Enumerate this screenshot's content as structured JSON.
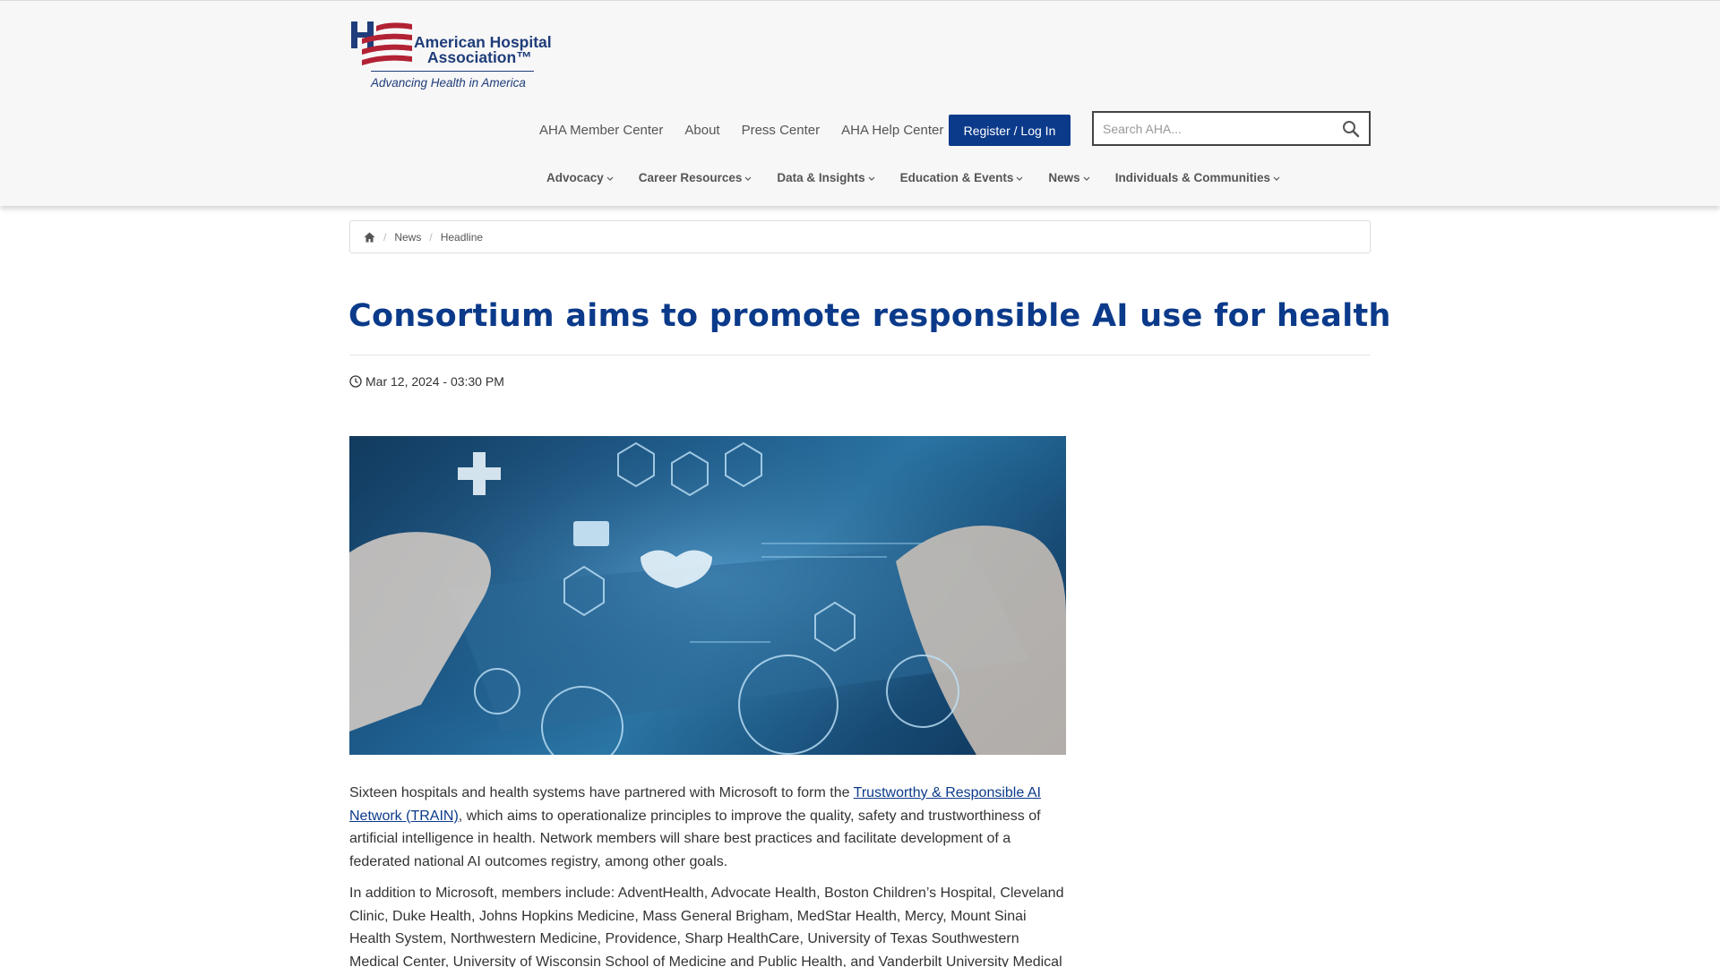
{
  "header": {
    "logo": {
      "line1": "American Hospital",
      "line2": "Association™",
      "tagline": "Advancing Health in America"
    },
    "utility_nav": [
      "AHA Member Center",
      "About",
      "Press Center",
      "AHA Help Center"
    ],
    "register_label": "Register / Log In",
    "search_placeholder": "Search AHA...",
    "main_nav": [
      "Advocacy",
      "Career Resources",
      "Data & Insights",
      "Education & Events",
      "News",
      "Individuals & Communities"
    ]
  },
  "breadcrumb": {
    "items": [
      "News",
      "Headline"
    ]
  },
  "article": {
    "title": "Consortium aims to promote responsible AI use for health",
    "date": "Mar 12, 2024 - 03:30 PM",
    "p1_before": "Sixteen hospitals and health systems have partnered with Microsoft to form the ",
    "p1_link": "Trustworthy & Responsible AI Network (TRAIN)",
    "p1_after": ", which aims to operationalize principles to improve the quality, safety and trustworthiness of artificial intelligence in health. Network members will share best practices and facilitate development of a federated national AI outcomes registry, among other goals.",
    "p2": "In addition to Microsoft, members include: AdventHealth, Advocate Health, Boston Children’s Hospital, Cleveland Clinic, Duke Health, Johns Hopkins Medicine, Mass General Brigham, MedStar Health, Mercy, Mount Sinai Health System, Northwestern Medicine, Providence, Sharp HealthCare, University of Texas Southwestern Medical Center, University of Wisconsin School of Medicine and Public Health, and Vanderbilt University Medical"
  },
  "colors": {
    "brand_blue": "#0b3a8a",
    "logo_red": "#b22234"
  }
}
